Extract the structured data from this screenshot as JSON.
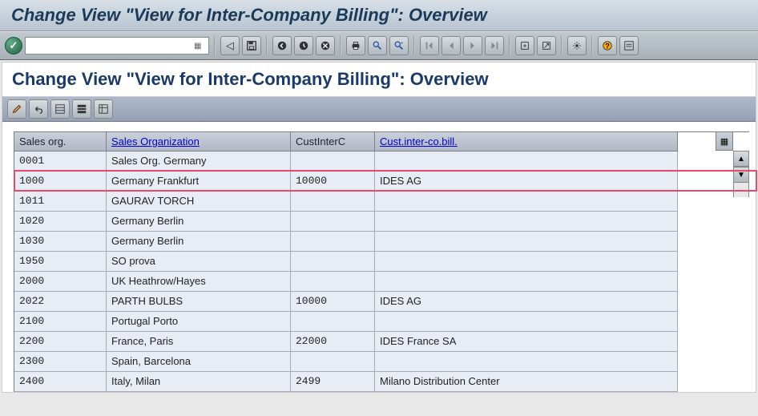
{
  "window_title": "Change View \"View for Inter-Company Billing\": Overview",
  "page_title": "Change View \"View for Inter-Company Billing\": Overview",
  "toolbar": {
    "icons": [
      "enter",
      "save",
      "back",
      "exit",
      "cancel",
      "print",
      "find",
      "find-next",
      "first-page",
      "prev-page",
      "next-page",
      "last-page",
      "create-entry",
      "new-entries",
      "copy",
      "delimit",
      "layout",
      "help",
      "settings"
    ]
  },
  "table": {
    "headers": {
      "col1": "Sales org.",
      "col2": "Sales Organization",
      "col3": "CustInterC",
      "col4": "Cust.inter-co.bill."
    },
    "rows": [
      {
        "c1": "0001",
        "c2": "Sales Org. Germany",
        "c3": "",
        "c4": ""
      },
      {
        "c1": "1000",
        "c2": "Germany Frankfurt",
        "c3": "10000",
        "c4": "IDES AG",
        "hl": true
      },
      {
        "c1": "1011",
        "c2": "GAURAV TORCH",
        "c3": "",
        "c4": ""
      },
      {
        "c1": "1020",
        "c2": "Germany Berlin",
        "c3": "",
        "c4": ""
      },
      {
        "c1": "1030",
        "c2": "Germany Berlin",
        "c3": "",
        "c4": ""
      },
      {
        "c1": "1950",
        "c2": "SO prova",
        "c3": "",
        "c4": ""
      },
      {
        "c1": "2000",
        "c2": "UK Heathrow/Hayes",
        "c3": "",
        "c4": ""
      },
      {
        "c1": "2022",
        "c2": "PARTH BULBS",
        "c3": "10000",
        "c4": "IDES AG"
      },
      {
        "c1": "2100",
        "c2": "Portugal Porto",
        "c3": "",
        "c4": ""
      },
      {
        "c1": "2200",
        "c2": "France, Paris",
        "c3": "22000",
        "c4": "IDES France SA"
      },
      {
        "c1": "2300",
        "c2": "Spain, Barcelona",
        "c3": "",
        "c4": ""
      },
      {
        "c1": "2400",
        "c2": "Italy, Milan",
        "c3": "2499",
        "c4": "Milano Distribution Center"
      }
    ]
  }
}
